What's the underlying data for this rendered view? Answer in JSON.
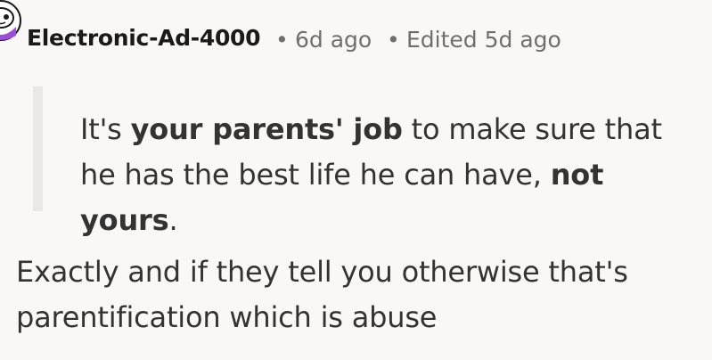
{
  "comment": {
    "author": "Electronic-Ad-4000",
    "separator": "•",
    "age": "6d ago",
    "edited": "Edited 5d ago",
    "avatar_icon": "snoo-avatar-icon",
    "quote": {
      "part1": "It's ",
      "bold1": "your parents' job",
      "part2": " to make sure that he has the best life he can have, ",
      "bold2": "not yours",
      "part3": "."
    },
    "body": "Exactly and if they tell you otherwise that's parentification which is abuse"
  },
  "colors": {
    "background": "#faf8f7",
    "text": "#333333",
    "meta": "#6f6f6f",
    "quote_bar": "#ebe7e5",
    "avatar_accent": "#9b4fd6"
  }
}
